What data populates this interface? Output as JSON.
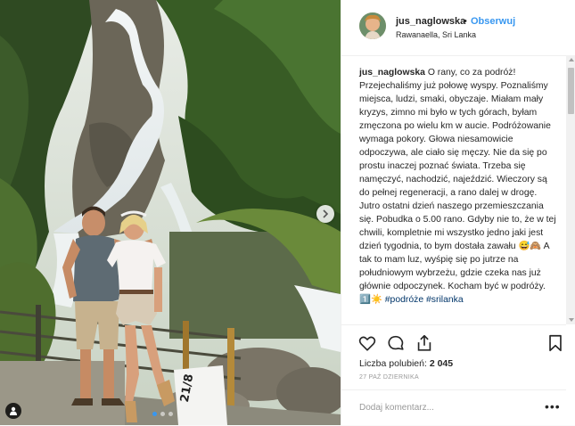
{
  "post": {
    "username": "jus_naglowska",
    "separator": "•",
    "follow_label": "Obserwuj",
    "location": "Rawanaella, Sri Lanka",
    "caption": {
      "author": "jus_naglowska",
      "text": "O rany, co za podróż! Przejechaliśmy już połowę wyspy. Poznaliśmy miejsca, ludzi, smaki, obyczaje. Miałam mały kryzys, zimno mi było w tych górach, byłam zmęczona po wielu km w aucie. Podróżowanie wymaga pokory. Głowa niesamowicie odpoczywa, ale ciało się męczy. Nie da się po prostu inaczej poznać świata. Trzeba się namęczyć, nachodzić, najeździć. Wieczory są do pełnej regeneracji, a rano dalej w drogę. Jutro ostatni dzień naszego przemieszczania się. Pobudka o 5.00 rano. Gdyby nie to, że w tej chwili, kompletnie mi wszystko jedno jaki jest dzień tygodnia, to bym dostała zawału 😅🙈 A tak to mam luz, wyśpię się po jutrze na południowym wybrzeżu, gdzie czeka nas już głównie odpoczynek. Kocham być w podróży.",
      "emoji_tail": "1️⃣☀️",
      "hashtags": [
        "#podróże",
        "#srilanka"
      ]
    },
    "likes_label": "Liczba polubień:",
    "likes_count": "2 045",
    "date": "27 PAŹ DZIERNIKA",
    "comment_placeholder": "Dodaj komentarz...",
    "more_label": "•••",
    "photo": {
      "sign_text": "21/8",
      "carousel_dots": 3,
      "active_dot": 0
    },
    "icons": {
      "like": "heart-icon",
      "comment": "comment-icon",
      "share": "share-icon",
      "save": "bookmark-icon",
      "next": "chevron-right-icon",
      "tag": "user-tag-icon"
    },
    "colors": {
      "link": "#3897f0",
      "hashtag": "#003569",
      "text": "#262626",
      "muted": "#999999"
    }
  }
}
